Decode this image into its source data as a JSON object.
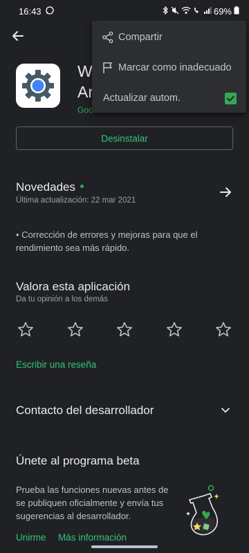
{
  "status_bar": {
    "time": "16:43",
    "battery": "69%"
  },
  "app": {
    "title_visible": "W",
    "title_visible_line2": "Ar",
    "developer_visible": "Goog"
  },
  "uninstall_label": "Desinstalar",
  "menu": {
    "items": [
      {
        "label": "Compartir",
        "icon": "share-icon"
      },
      {
        "label": "Marcar como inadecuado",
        "icon": "flag-icon"
      },
      {
        "label": "Actualizar autom.",
        "checked": true
      }
    ]
  },
  "whats_new": {
    "title": "Novedades",
    "updated": "Última actualización: 22 mar 2021",
    "notes": "• Corrección de errores y mejoras para que el rendimiento sea más rápido."
  },
  "rate": {
    "title": "Valora esta aplicación",
    "subtitle": "Da tu opinión a los demás",
    "stars": 5,
    "write_review": "Escribir una reseña"
  },
  "developer_contact": {
    "title": "Contacto del desarrollador"
  },
  "beta": {
    "title": "Únete al programa beta",
    "description": "Prueba las funciones nuevas antes de se publiquen oficialmente y envía tus sugerencias al desarrollador.",
    "join": "Unirme",
    "more_info": "Más información"
  },
  "colors": {
    "background": "#202124",
    "accent_green": "#34c37a",
    "menu_bg": "#2d2e31"
  }
}
